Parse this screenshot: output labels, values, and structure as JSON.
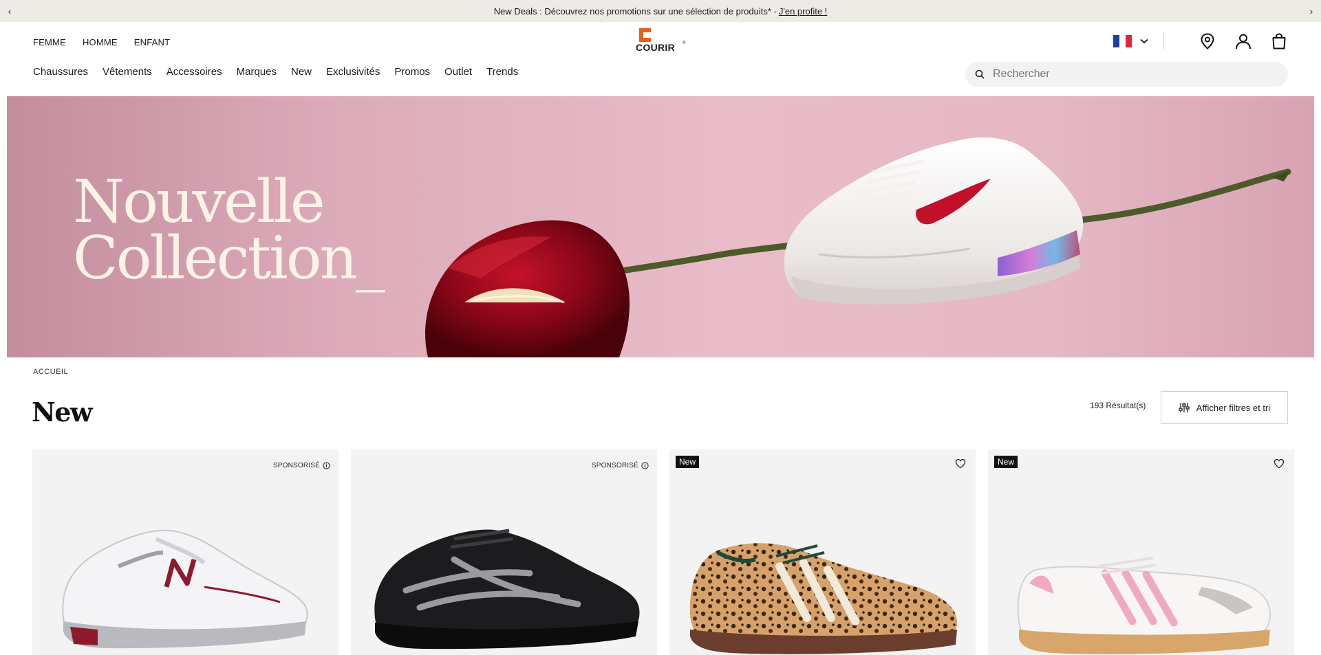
{
  "promo": {
    "text": "New Deals : Découvrez nos promotions sur une sélection de produits* -",
    "link": "J'en profite !",
    "prev_arrow": "‹",
    "next_arrow": "›"
  },
  "header": {
    "gender_nav": [
      "FEMME",
      "HOMME",
      "ENFANT"
    ],
    "logo_text": "COURIR",
    "logo_mark": "®",
    "brand_color": "#e8611a",
    "main_nav": [
      "Chaussures",
      "Vêtements",
      "Accessoires",
      "Marques",
      "New",
      "Exclusivités",
      "Promos",
      "Outlet",
      "Trends"
    ],
    "search_placeholder": "Rechercher",
    "icons": [
      "france-flag-icon",
      "chevron-down-icon",
      "store-locator-icon",
      "account-icon",
      "bag-icon",
      "search-icon"
    ]
  },
  "hero": {
    "title_line1": "Nouvelle",
    "title_line2": "Collection_"
  },
  "breadcrumb": "ACCUEIL",
  "listing": {
    "title": "New",
    "results": "193 Résultat(s)",
    "filter_button": "Afficher filtres et tri"
  },
  "products": [
    {
      "tag": "SPONSORISÉ",
      "type": "sponsored"
    },
    {
      "tag": "SPONSORISÉ",
      "type": "sponsored"
    },
    {
      "tag": "New",
      "type": "new"
    },
    {
      "tag": "New",
      "type": "new"
    }
  ]
}
